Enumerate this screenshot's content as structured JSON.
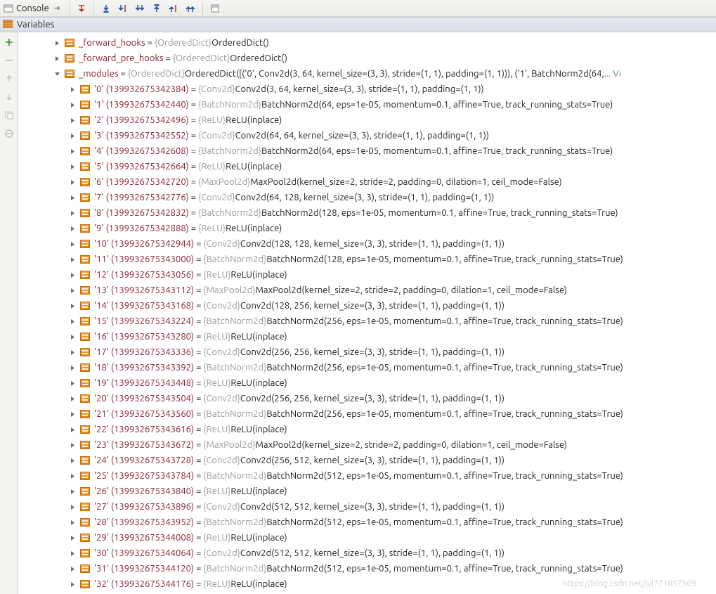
{
  "toolbar": {
    "console_label": "Console"
  },
  "panel": {
    "title": "Variables"
  },
  "watermark": "https://blog.csdn.net/lyl771857509",
  "tree": {
    "top": [
      {
        "name": "_forward_hooks",
        "type": "{OrderedDict}",
        "value": "OrderedDict()"
      },
      {
        "name": "_forward_pre_hooks",
        "type": "{OrderedDict}",
        "value": "OrderedDict()"
      }
    ],
    "modules_key": "_modules",
    "modules_type": "{OrderedDict}",
    "modules_value": "OrderedDict([('0', Conv2d(3, 64, kernel_size=(3, 3), stride=(1, 1), padding=(1, 1))), ('1', BatchNorm2d(64,",
    "modules_tail": "... Vi",
    "children": [
      {
        "k": "'0' (139932675342384)",
        "t": "{Conv2d}",
        "v": "Conv2d(3, 64, kernel_size=(3, 3), stride=(1, 1), padding=(1, 1))"
      },
      {
        "k": "'1' (139932675342440)",
        "t": "{BatchNorm2d}",
        "v": "BatchNorm2d(64, eps=1e-05, momentum=0.1, affine=True, track_running_stats=True)"
      },
      {
        "k": "'2' (139932675342496)",
        "t": "{ReLU}",
        "v": "ReLU(inplace)"
      },
      {
        "k": "'3' (139932675342552)",
        "t": "{Conv2d}",
        "v": "Conv2d(64, 64, kernel_size=(3, 3), stride=(1, 1), padding=(1, 1))"
      },
      {
        "k": "'4' (139932675342608)",
        "t": "{BatchNorm2d}",
        "v": "BatchNorm2d(64, eps=1e-05, momentum=0.1, affine=True, track_running_stats=True)"
      },
      {
        "k": "'5' (139932675342664)",
        "t": "{ReLU}",
        "v": "ReLU(inplace)"
      },
      {
        "k": "'6' (139932675342720)",
        "t": "{MaxPool2d}",
        "v": "MaxPool2d(kernel_size=2, stride=2, padding=0, dilation=1, ceil_mode=False)"
      },
      {
        "k": "'7' (139932675342776)",
        "t": "{Conv2d}",
        "v": "Conv2d(64, 128, kernel_size=(3, 3), stride=(1, 1), padding=(1, 1))"
      },
      {
        "k": "'8' (139932675342832)",
        "t": "{BatchNorm2d}",
        "v": "BatchNorm2d(128, eps=1e-05, momentum=0.1, affine=True, track_running_stats=True)"
      },
      {
        "k": "'9' (139932675342888)",
        "t": "{ReLU}",
        "v": "ReLU(inplace)"
      },
      {
        "k": "'10' (139932675342944)",
        "t": "{Conv2d}",
        "v": "Conv2d(128, 128, kernel_size=(3, 3), stride=(1, 1), padding=(1, 1))"
      },
      {
        "k": "'11' (139932675343000)",
        "t": "{BatchNorm2d}",
        "v": "BatchNorm2d(128, eps=1e-05, momentum=0.1, affine=True, track_running_stats=True)"
      },
      {
        "k": "'12' (139932675343056)",
        "t": "{ReLU}",
        "v": "ReLU(inplace)"
      },
      {
        "k": "'13' (139932675343112)",
        "t": "{MaxPool2d}",
        "v": "MaxPool2d(kernel_size=2, stride=2, padding=0, dilation=1, ceil_mode=False)"
      },
      {
        "k": "'14' (139932675343168)",
        "t": "{Conv2d}",
        "v": "Conv2d(128, 256, kernel_size=(3, 3), stride=(1, 1), padding=(1, 1))"
      },
      {
        "k": "'15' (139932675343224)",
        "t": "{BatchNorm2d}",
        "v": "BatchNorm2d(256, eps=1e-05, momentum=0.1, affine=True, track_running_stats=True)"
      },
      {
        "k": "'16' (139932675343280)",
        "t": "{ReLU}",
        "v": "ReLU(inplace)"
      },
      {
        "k": "'17' (139932675343336)",
        "t": "{Conv2d}",
        "v": "Conv2d(256, 256, kernel_size=(3, 3), stride=(1, 1), padding=(1, 1))"
      },
      {
        "k": "'18' (139932675343392)",
        "t": "{BatchNorm2d}",
        "v": "BatchNorm2d(256, eps=1e-05, momentum=0.1, affine=True, track_running_stats=True)"
      },
      {
        "k": "'19' (139932675343448)",
        "t": "{ReLU}",
        "v": "ReLU(inplace)"
      },
      {
        "k": "'20' (139932675343504)",
        "t": "{Conv2d}",
        "v": "Conv2d(256, 256, kernel_size=(3, 3), stride=(1, 1), padding=(1, 1))"
      },
      {
        "k": "'21' (139932675343560)",
        "t": "{BatchNorm2d}",
        "v": "BatchNorm2d(256, eps=1e-05, momentum=0.1, affine=True, track_running_stats=True)"
      },
      {
        "k": "'22' (139932675343616)",
        "t": "{ReLU}",
        "v": "ReLU(inplace)"
      },
      {
        "k": "'23' (139932675343672)",
        "t": "{MaxPool2d}",
        "v": "MaxPool2d(kernel_size=2, stride=2, padding=0, dilation=1, ceil_mode=False)"
      },
      {
        "k": "'24' (139932675343728)",
        "t": "{Conv2d}",
        "v": "Conv2d(256, 512, kernel_size=(3, 3), stride=(1, 1), padding=(1, 1))"
      },
      {
        "k": "'25' (139932675343784)",
        "t": "{BatchNorm2d}",
        "v": "BatchNorm2d(512, eps=1e-05, momentum=0.1, affine=True, track_running_stats=True)"
      },
      {
        "k": "'26' (139932675343840)",
        "t": "{ReLU}",
        "v": "ReLU(inplace)"
      },
      {
        "k": "'27' (139932675343896)",
        "t": "{Conv2d}",
        "v": "Conv2d(512, 512, kernel_size=(3, 3), stride=(1, 1), padding=(1, 1))"
      },
      {
        "k": "'28' (139932675343952)",
        "t": "{BatchNorm2d}",
        "v": "BatchNorm2d(512, eps=1e-05, momentum=0.1, affine=True, track_running_stats=True)"
      },
      {
        "k": "'29' (139932675344008)",
        "t": "{ReLU}",
        "v": "ReLU(inplace)"
      },
      {
        "k": "'30' (139932675344064)",
        "t": "{Conv2d}",
        "v": "Conv2d(512, 512, kernel_size=(3, 3), stride=(1, 1), padding=(1, 1))"
      },
      {
        "k": "'31' (139932675344120)",
        "t": "{BatchNorm2d}",
        "v": "BatchNorm2d(512, eps=1e-05, momentum=0.1, affine=True, track_running_stats=True)"
      },
      {
        "k": "'32' (139932675344176)",
        "t": "{ReLU}",
        "v": "ReLU(inplace)"
      }
    ]
  }
}
